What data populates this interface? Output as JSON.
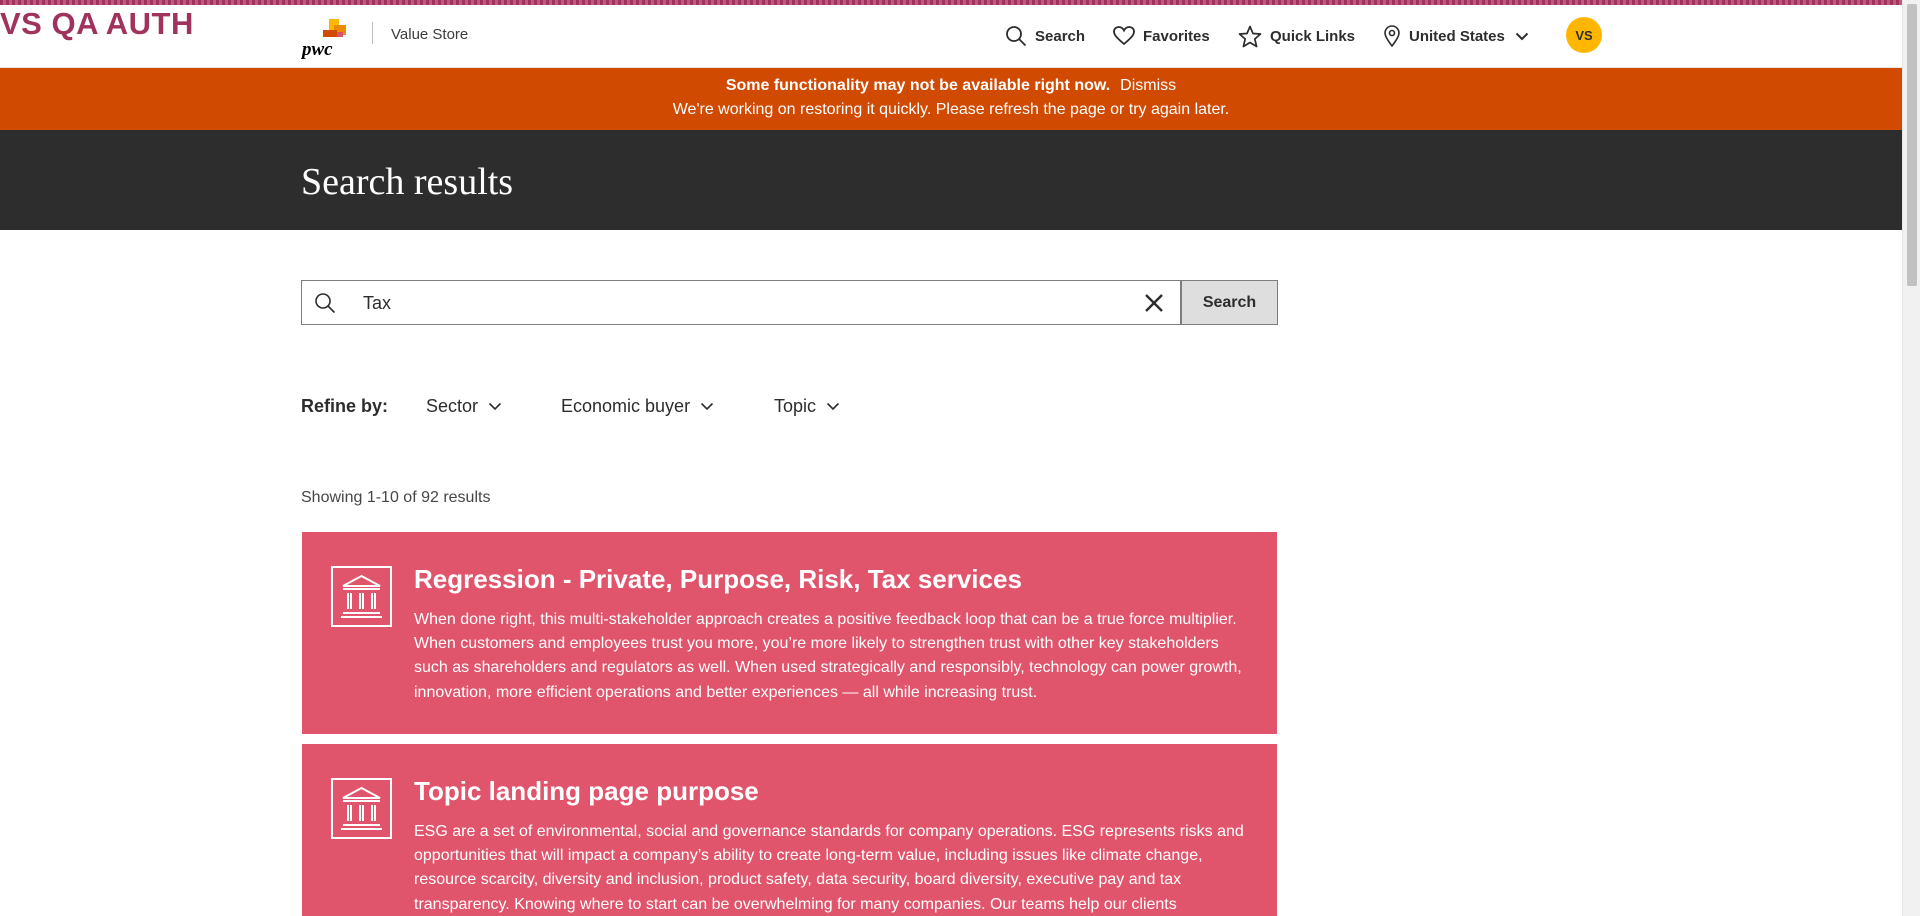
{
  "environment_label": "VS QA AUTH",
  "header": {
    "logo_text": "pwc",
    "site_name": "Value Store",
    "nav": {
      "search": "Search",
      "favorites": "Favorites",
      "quick_links": "Quick Links",
      "country": "United States"
    },
    "avatar_initials": "VS"
  },
  "banner": {
    "title": "Some functionality may not be available right now.",
    "dismiss": "Dismiss",
    "message": "We're working on restoring it quickly. Please refresh the page or try again later."
  },
  "hero": {
    "title": "Search results"
  },
  "search": {
    "value": "Tax",
    "button": "Search"
  },
  "refine": {
    "label": "Refine by:",
    "filters": [
      "Sector",
      "Economic buyer",
      "Topic"
    ]
  },
  "results": {
    "count_text": "Showing 1-10 of 92 results",
    "items": [
      {
        "title": "Regression - Private, Purpose, Risk, Tax services",
        "description": "When done right, this multi-stakeholder approach creates a positive feedback loop that can be a true force multiplier. When customers and employees trust you more, you’re more likely to strengthen trust with other key stakeholders such as shareholders and regulators as well. When used strategically and responsibly, technology can power growth, innovation, more efficient operations and better experiences — all while increasing trust.",
        "icon": "institution-icon"
      },
      {
        "title": "Topic landing page purpose",
        "description": "ESG are a set of environmental, social and governance standards for company operations. ESG represents risks and opportunities that will impact a company’s ability to create long-term value, including issues like climate change, resource scarcity, diversity and inclusion, product safety, data security, board diversity, executive pay and tax transparency. Knowing where to start can be overwhelming for many companies. Our teams help our clients",
        "icon": "institution-icon"
      }
    ]
  },
  "colors": {
    "env_label": "#a0335e",
    "banner_bg": "#d04a02",
    "hero_bg": "#2d2d2d",
    "card_bg": "#e0556c",
    "avatar_bg": "#ffb600"
  }
}
